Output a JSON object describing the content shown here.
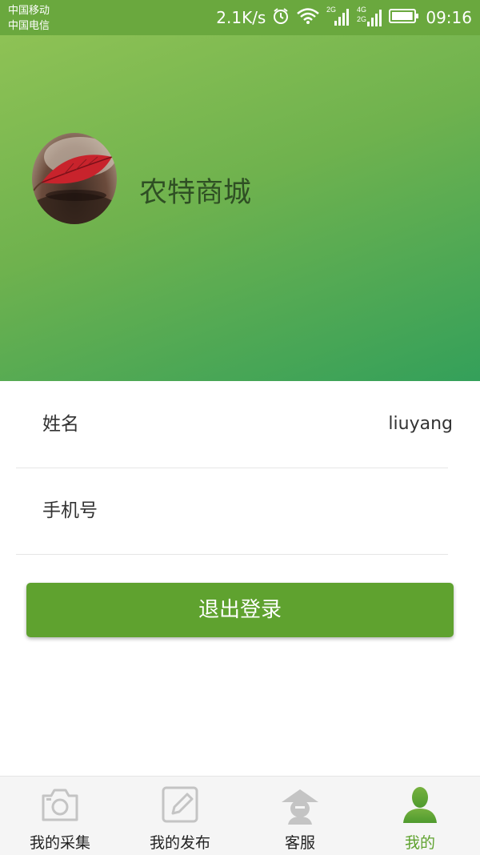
{
  "status_bar": {
    "carrier_1": "中国移动",
    "carrier_2": "中国电信",
    "net_speed": "2.1K/s",
    "sim1_network": "2G",
    "sim2_network_top": "4G",
    "sim2_network_bottom": "2G",
    "battery_level": 0.95,
    "time": "09:16",
    "icons": [
      "alarm-icon",
      "wifi-icon",
      "signal-icon",
      "signal-icon",
      "battery-icon"
    ]
  },
  "header": {
    "app_name": "农特商城",
    "avatar": "leaf-avatar"
  },
  "profile": {
    "name_label": "姓名",
    "name_value": "liuyang",
    "phone_label": "手机号",
    "phone_value": ""
  },
  "logout_button": "退出登录",
  "tabs": [
    {
      "label": "我的采集",
      "icon": "camera-icon",
      "active": false
    },
    {
      "label": "我的发布",
      "icon": "edit-icon",
      "active": false
    },
    {
      "label": "客服",
      "icon": "customer-service-icon",
      "active": false
    },
    {
      "label": "我的",
      "icon": "user-icon",
      "active": true
    }
  ],
  "colors": {
    "brand_green": "#5fa22f",
    "status_bar": "#6aa83e",
    "header_gradient_start": "#8ec255",
    "header_gradient_end": "#34a05a",
    "tab_inactive_icon": "#c4c4c4"
  }
}
